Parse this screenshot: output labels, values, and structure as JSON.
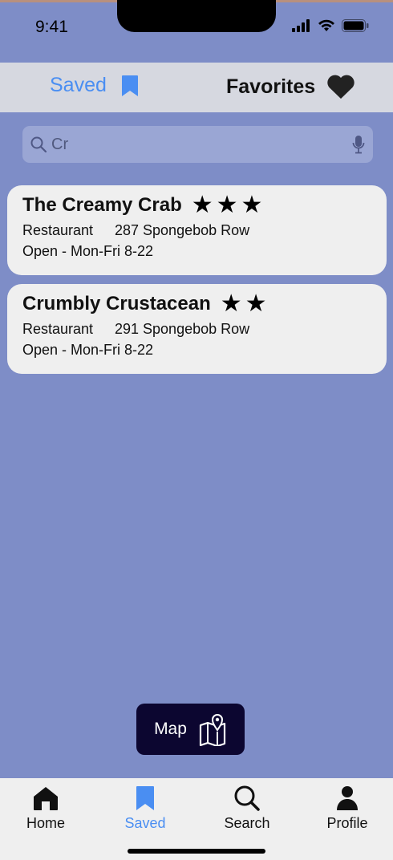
{
  "status_bar": {
    "time": "9:41"
  },
  "segments": {
    "saved_label": "Saved",
    "favorites_label": "Favorites"
  },
  "search": {
    "value": "Cr"
  },
  "results": [
    {
      "name": "The Creamy Crab",
      "stars": "★★★",
      "rating": 3,
      "type": "Restaurant",
      "address": "287 Spongebob Row",
      "hours": "Open - Mon-Fri 8-22"
    },
    {
      "name": "Crumbly Crustacean",
      "stars": "★★",
      "rating": 2,
      "type": "Restaurant",
      "address": "291 Spongebob Row",
      "hours": "Open - Mon-Fri 8-22"
    }
  ],
  "map_button": {
    "label": "Map"
  },
  "tab_bar": {
    "items": [
      {
        "label": "Home",
        "icon": "home-icon"
      },
      {
        "label": "Saved",
        "icon": "bookmark-icon",
        "active": true
      },
      {
        "label": "Search",
        "icon": "search-icon"
      },
      {
        "label": "Profile",
        "icon": "person-icon"
      }
    ]
  },
  "colors": {
    "background": "#7e8dc7",
    "accent": "#4a8ef2",
    "map_button": "#0c0630",
    "card": "#efefef"
  }
}
